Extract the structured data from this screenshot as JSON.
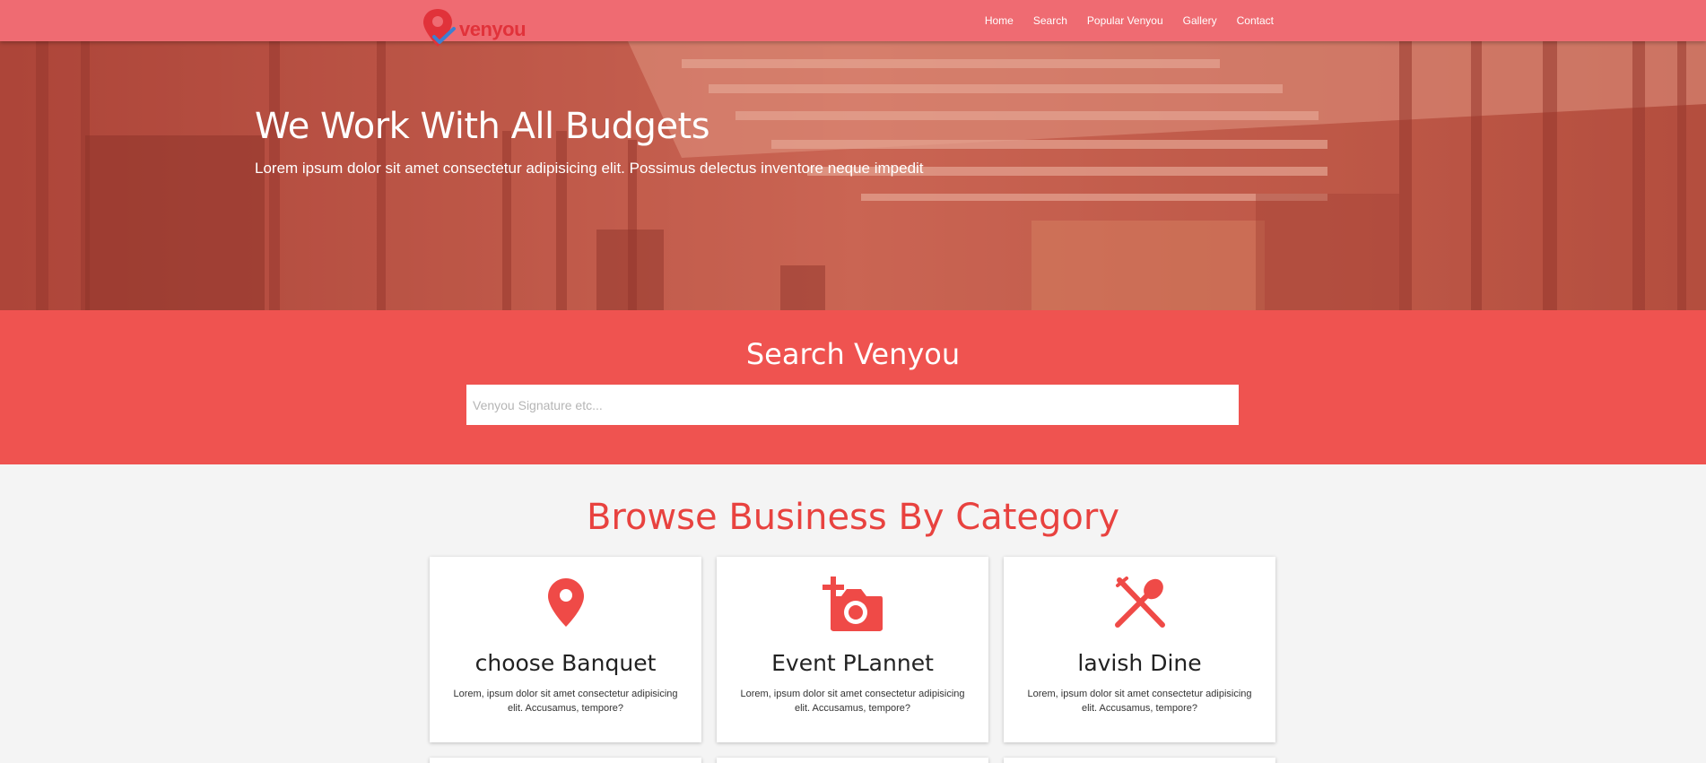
{
  "brand": {
    "name": "venyou",
    "logo_icon": "map-pin-check-icon",
    "color": "#e1323a"
  },
  "nav": {
    "items": [
      {
        "label": "Home"
      },
      {
        "label": "Search"
      },
      {
        "label": "Popular Venyou"
      },
      {
        "label": "Gallery"
      },
      {
        "label": "Contact"
      }
    ],
    "background": "#ef6b72"
  },
  "hero": {
    "title": "We Work With All Budgets",
    "subtitle": "Lorem ipsum dolor sit amet consectetur adipisicing elit. Possimus delectus inventore neque impedit"
  },
  "search": {
    "title": "Search Venyou",
    "placeholder": "Venyou Signature etc...",
    "value": "",
    "background": "#ef5350"
  },
  "categories": {
    "title": "Browse Business By Category",
    "accent": "#e8423f",
    "items": [
      {
        "icon": "location-pin-icon",
        "title": "choose Banquet",
        "text": "Lorem, ipsum dolor sit amet consectetur adipisicing elit. Accusamus, tempore?"
      },
      {
        "icon": "add-camera-icon",
        "title": "Event PLannet",
        "text": "Lorem, ipsum dolor sit amet consectetur adipisicing elit. Accusamus, tempore?"
      },
      {
        "icon": "fork-spoon-icon",
        "title": "lavish Dine",
        "text": "Lorem, ipsum dolor sit amet consectetur adipisicing elit. Accusamus, tempore?"
      }
    ]
  }
}
